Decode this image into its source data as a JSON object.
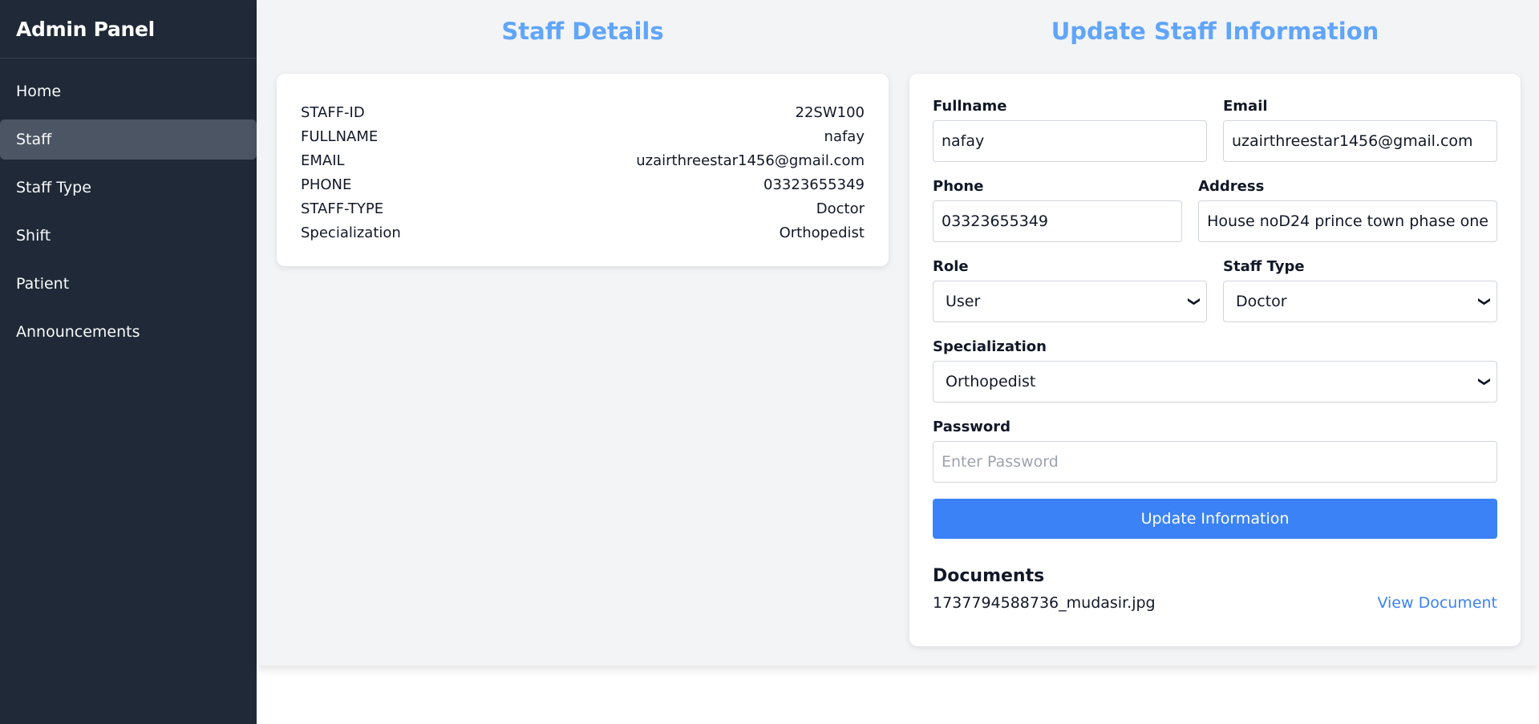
{
  "sidebar": {
    "title": "Admin Panel",
    "items": [
      {
        "label": "Home"
      },
      {
        "label": "Staff"
      },
      {
        "label": "Staff Type"
      },
      {
        "label": "Shift"
      },
      {
        "label": "Patient"
      },
      {
        "label": "Announcements"
      }
    ],
    "active_index": 1
  },
  "details": {
    "title": "Staff Details",
    "rows": [
      {
        "label": "STAFF-ID",
        "value": "22SW100"
      },
      {
        "label": "FULLNAME",
        "value": "nafay"
      },
      {
        "label": "EMAIL",
        "value": "uzairthreestar1456@gmail.com"
      },
      {
        "label": "PHONE",
        "value": "03323655349"
      },
      {
        "label": "STAFF-TYPE",
        "value": "Doctor"
      },
      {
        "label": "Specialization",
        "value": "Orthopedist"
      }
    ]
  },
  "form": {
    "title": "Update Staff Information",
    "fullname": {
      "label": "Fullname",
      "value": "nafay"
    },
    "email": {
      "label": "Email",
      "value": "uzairthreestar1456@gmail.com"
    },
    "phone": {
      "label": "Phone",
      "value": "03323655349"
    },
    "address": {
      "label": "Address",
      "value": "House noD24 prince town phase one"
    },
    "role": {
      "label": "Role",
      "value": "User"
    },
    "staff_type": {
      "label": "Staff Type",
      "value": "Doctor"
    },
    "specialization": {
      "label": "Specialization",
      "value": "Orthopedist"
    },
    "password": {
      "label": "Password",
      "placeholder": "Enter Password"
    },
    "submit_label": "Update Information"
  },
  "documents": {
    "title": "Documents",
    "file_name": "1737794588736_mudasir.jpg",
    "link_label": "View Document"
  },
  "colors": {
    "sidebar_bg": "#1f2937",
    "accent": "#3b82f6",
    "title": "#60a5fa"
  }
}
